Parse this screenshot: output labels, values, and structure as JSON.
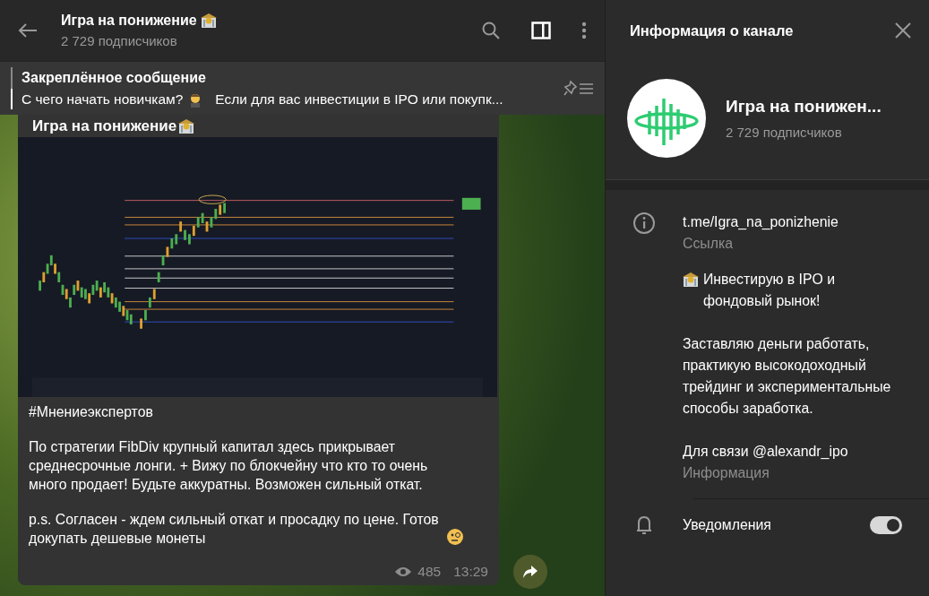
{
  "chat_header": {
    "title": "Игра на понижение",
    "subtitle": "2 729 подписчиков"
  },
  "pinned": {
    "label": "Закреплённое сообщение",
    "preview_start": "С чего начать новичкам?",
    "preview_rest": "Если для вас инвестиции в IPO или покупк..."
  },
  "message": {
    "author": "Игра на понижение",
    "paragraphs": [
      "#Мнениеэкспертов",
      "По стратегии FibDiv крупный капитал здесь прикрывает среднесрочные лонги. + Вижу по блокчейну что кто то очень много продает! Будьте аккуратны. Возможен сильный откат.",
      "p.s. Согласен - ждем сильный откат и просадку по цене. Готов докупать дешевые монеты"
    ],
    "views": "485",
    "time": "13:29"
  },
  "info_panel": {
    "title": "Информация о канале",
    "channel_name": "Игра на понижен...",
    "subscribers": "2 729 подписчиков",
    "link": {
      "value": "t.me/Igra_na_ponizhenie",
      "label": "Ссылка"
    },
    "description": {
      "paragraphs": [
        "Инвестирую в IPO и фондовый рынок!",
        "Заставляю деньги работать, практикую высокодоходный трейдинг и экспериментальные способы заработка.",
        "Для связи @alexandr_ipo"
      ],
      "label": "Информация"
    },
    "notifications": {
      "label": "Уведомления",
      "on": true
    }
  }
}
